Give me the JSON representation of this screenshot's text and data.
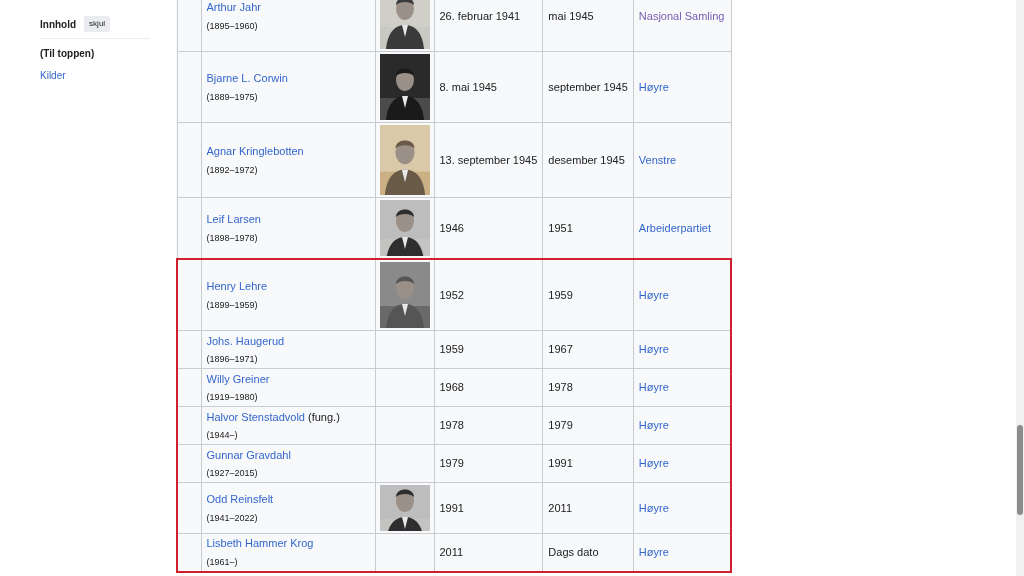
{
  "sidebar": {
    "title": "Innhold",
    "toggle": "skjul",
    "items": [
      {
        "label": "(Til toppen)",
        "selected": true
      },
      {
        "label": "Kilder",
        "selected": false
      }
    ]
  },
  "table": {
    "rows": [
      {
        "name": "Arthur Jahr",
        "years": "(1895–1960)",
        "photo": {
          "kind": "portrait"
        },
        "start": "26. februar 1941",
        "end": "mai 1945",
        "party": "Nasjonal Samling",
        "visited": true,
        "highlighted": false
      },
      {
        "name": "Bjarne L. Corwin",
        "years": "(1889–1975)",
        "photo": {
          "kind": "portrait"
        },
        "start": "8. mai 1945",
        "end": "september 1945",
        "party": "Høyre",
        "visited": false,
        "highlighted": false
      },
      {
        "name": "Agnar Kringlebotten",
        "years": "(1892–1972)",
        "photo": {
          "kind": "tall"
        },
        "start": "13. september 1945",
        "end": "desember 1945",
        "party": "Venstre",
        "visited": false,
        "highlighted": false
      },
      {
        "name": "Leif Larsen",
        "years": "(1898–1978)",
        "photo": {
          "kind": "short"
        },
        "start": "1946",
        "end": "1951",
        "party": "Arbeiderpartiet",
        "visited": false,
        "highlighted": false
      },
      {
        "name": "Henry Lehre",
        "years": "(1899–1959)",
        "photo": {
          "kind": "portrait"
        },
        "start": "1952",
        "end": "1959",
        "party": "Høyre",
        "visited": false,
        "highlighted": true
      },
      {
        "name": "Johs. Haugerud",
        "years": "(1896–1971)",
        "start": "1959",
        "end": "1967",
        "party": "Høyre",
        "visited": false,
        "highlighted": true
      },
      {
        "name": "Willy Greiner",
        "years": "(1919–1980)",
        "start": "1968",
        "end": "1978",
        "party": "Høyre",
        "visited": false,
        "highlighted": true
      },
      {
        "name": "Halvor Stenstadvold",
        "note": "(fung.)",
        "years": "(1944–)",
        "start": "1978",
        "end": "1979",
        "party": "Høyre",
        "visited": false,
        "highlighted": true
      },
      {
        "name": "Gunnar Gravdahl",
        "years": "(1927–2015)",
        "start": "1979",
        "end": "1991",
        "party": "Høyre",
        "visited": false,
        "highlighted": true
      },
      {
        "name": "Odd Reinsfelt",
        "years": "(1941–2022)",
        "photo": {
          "kind": "wide"
        },
        "start": "1991",
        "end": "2011",
        "party": "Høyre",
        "visited": false,
        "highlighted": true
      },
      {
        "name": "Lisbeth Hammer Krog",
        "years": "(1961–)",
        "start": "2011",
        "end": "Dags dato",
        "party": "Høyre",
        "visited": false,
        "highlighted": true
      }
    ]
  }
}
